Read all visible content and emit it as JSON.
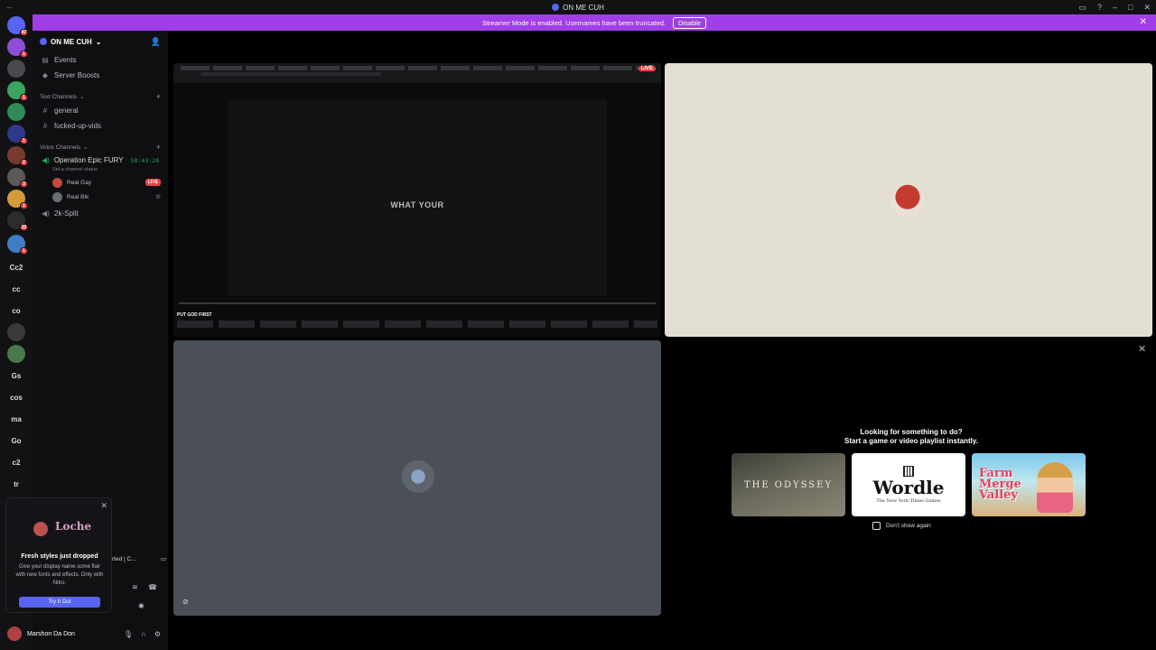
{
  "window": {
    "title": "ON ME CUH",
    "back_glyph": "←"
  },
  "banner": {
    "message": "Streamer Mode is enabled. Usernames have been truncated.",
    "disable_label": "Disable"
  },
  "rail": {
    "servers": [
      {
        "label": "",
        "color": "#5865f2",
        "badge": "47"
      },
      {
        "label": "",
        "color": "#8e4fd6",
        "badge": "1"
      },
      {
        "label": "",
        "color": "#4a4a4e",
        "badge": ""
      },
      {
        "label": "",
        "color": "#3ba55d",
        "badge": "1"
      },
      {
        "label": "",
        "color": "#2e8b57",
        "badge": ""
      },
      {
        "label": "",
        "color": "#2d3a8c",
        "badge": "1"
      },
      {
        "label": "",
        "color": "#7a3b2f",
        "badge": "2"
      },
      {
        "label": "",
        "color": "#5a5a5a",
        "badge": "3"
      },
      {
        "label": "",
        "color": "#d59b3a",
        "badge": "1"
      },
      {
        "label": "",
        "color": "#2c2c2c",
        "badge": "23"
      },
      {
        "label": "",
        "color": "#3e7fc4",
        "badge": "1"
      },
      {
        "label": "Cc2",
        "color": "",
        "badge": ""
      },
      {
        "label": "cc",
        "color": "",
        "badge": ""
      },
      {
        "label": "co",
        "color": "",
        "badge": ""
      },
      {
        "label": "",
        "color": "#3a3a3a",
        "badge": ""
      },
      {
        "label": "",
        "color": "#477a4a",
        "badge": ""
      },
      {
        "label": "Gs",
        "color": "",
        "badge": ""
      },
      {
        "label": "cos",
        "color": "",
        "badge": ""
      },
      {
        "label": "ma",
        "color": "",
        "badge": ""
      },
      {
        "label": "Go",
        "color": "",
        "badge": ""
      },
      {
        "label": "c2",
        "color": "",
        "badge": ""
      },
      {
        "label": "tr",
        "color": "",
        "badge": ""
      }
    ]
  },
  "sidebar": {
    "server_name": "ON ME CUH",
    "items": [
      {
        "label": "Events"
      },
      {
        "label": "Server Boosts"
      }
    ],
    "text_category": "Text Channels",
    "text_channels": [
      "general",
      "fucked-up-vids"
    ],
    "voice_category": "Voice Channels",
    "voice_channel": {
      "name": "Operation Epic FURY",
      "timer": "58:43:28",
      "status_prompt": "Set a channel status"
    },
    "voice_users": [
      {
        "name": "Real Gay",
        "live": "LIVE"
      },
      {
        "name": "Real Blk"
      }
    ],
    "other_voice": "2k-Split"
  },
  "nitro_popup": {
    "name_preview": "Loche",
    "title": "Fresh styles just dropped",
    "body": "Give your display name some flair with new fonts and effects. Only with Nitro.",
    "cta": "Try It Out"
  },
  "overlap": {
    "text": "rted | C..."
  },
  "user_panel": {
    "name": "Marshon Da Don",
    "status": ""
  },
  "stream_tile": {
    "live_badge": "LIVE",
    "overlay_text": "WHAT YOUR",
    "video_title": "PUT GOD FIRST"
  },
  "activity": {
    "title": "Looking for something to do?",
    "subtitle": "Start a game or video playlist instantly.",
    "cards": [
      {
        "title": "THE ODYSSEY"
      },
      {
        "title": "Wordle",
        "subtitle": "The New York Times Games"
      },
      {
        "title": "Farm Merge Valley"
      }
    ],
    "dont_show": "Don't show again"
  }
}
